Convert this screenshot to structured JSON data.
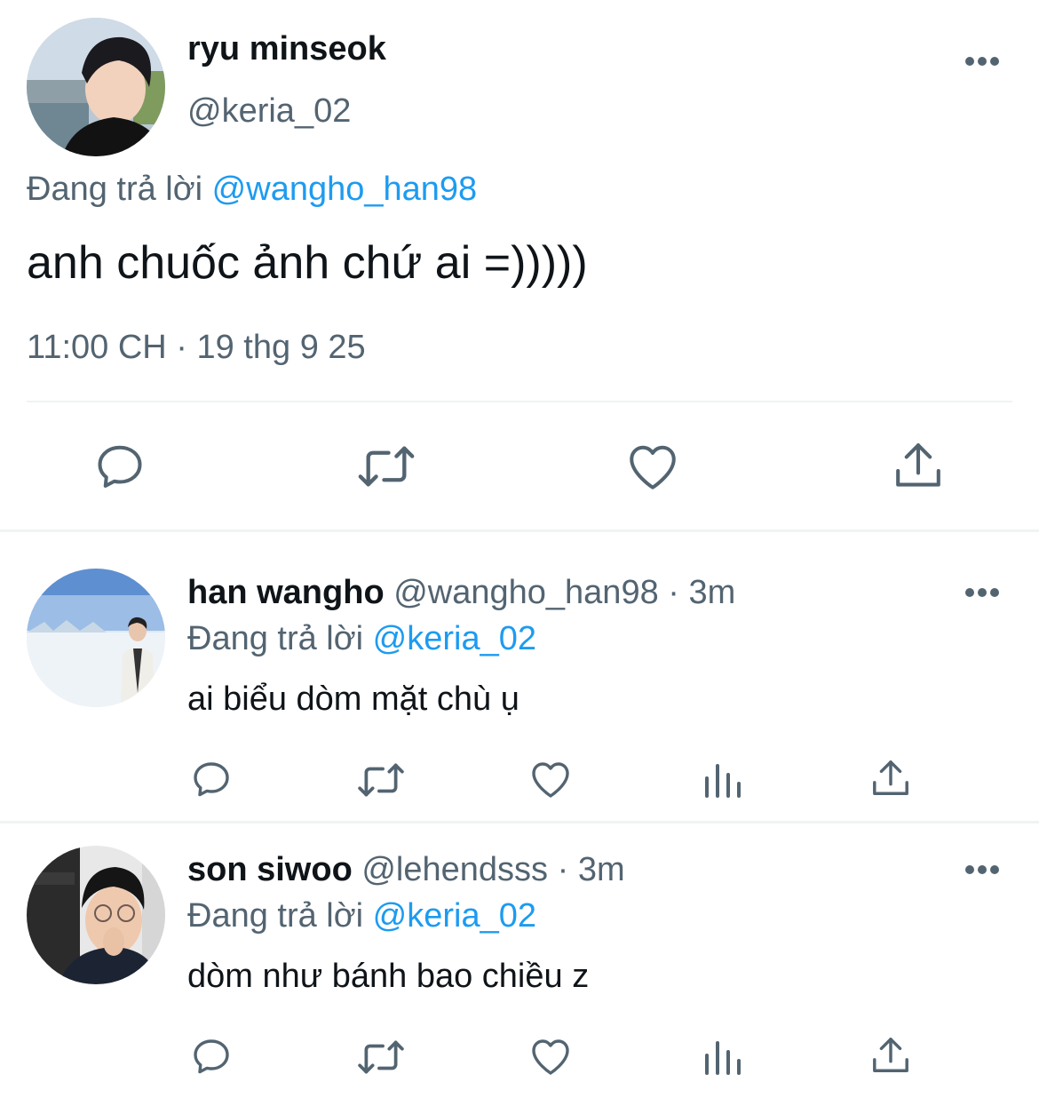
{
  "main_tweet": {
    "display_name": "ryu minseok",
    "handle": "@keria_02",
    "reply_prefix": "Đang trả lời",
    "reply_to": "@wangho_han98",
    "text": "anh chuốc ảnh chứ ai =)))))",
    "timestamp": "11:00 CH · 19 thg 9 25"
  },
  "replies": [
    {
      "display_name": "han wangho",
      "handle": "@wangho_han98",
      "time": "· 3m",
      "reply_prefix": "Đang trả lời",
      "reply_to": "@keria_02",
      "text": "ai biểu dòm mặt chù ụ"
    },
    {
      "display_name": "son siwoo",
      "handle": "@lehendsss",
      "time": "· 3m",
      "reply_prefix": "Đang trả lời",
      "reply_to": "@keria_02",
      "text": "dòm như bánh bao chiều z"
    }
  ],
  "icons": {
    "reply": "reply-icon",
    "retweet": "retweet-icon",
    "like": "like-icon",
    "views": "views-icon",
    "share": "share-icon",
    "more": "more-icon"
  },
  "colors": {
    "link": "#1d9bf0",
    "muted": "#536471",
    "text": "#0f1419",
    "divider": "#eff3f4"
  }
}
